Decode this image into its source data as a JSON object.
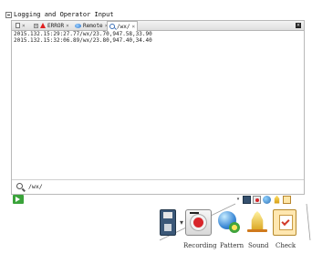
{
  "panel": {
    "title": "Logging and Operator Input",
    "tabs": [
      {
        "label": ""
      },
      {
        "label": "ERROR"
      },
      {
        "label": "Remote"
      },
      {
        "label": "/wx/"
      }
    ]
  },
  "log": {
    "lines": [
      "2015.132.15:29:27.77/wx/23.70,947.58,33.90",
      "2015.132.15:32:06.89/wx/23.80,947.40,34.40"
    ]
  },
  "search": {
    "value": "/wx/"
  },
  "zoom_toolbar": {
    "labels": {
      "recording": "Recording",
      "pattern": "Pattern",
      "sound": "Sound",
      "check": "Check"
    }
  },
  "colors": {
    "accent": "#3aa33a",
    "error": "#e02020",
    "zoom_line": "#9a9a9a"
  },
  "icons": [
    "collapse-icon",
    "page-icon",
    "close-icon",
    "warning-icon",
    "remote-icon",
    "search-icon",
    "execute-icon",
    "save-icon",
    "dropdown-icon",
    "record-icon",
    "pattern-icon",
    "bell-icon",
    "checklist-icon"
  ]
}
